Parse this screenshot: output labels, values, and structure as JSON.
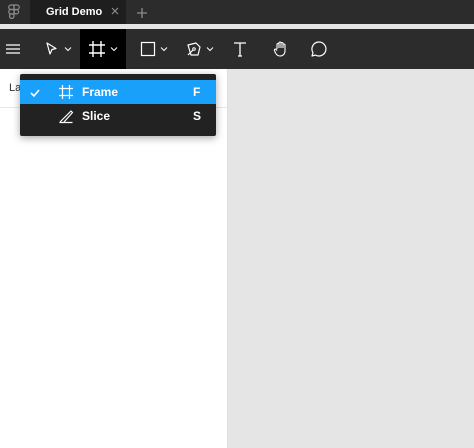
{
  "tabbar": {
    "tab_title": "Grid Demo",
    "icons": [
      "figma-logo-icon",
      "close-icon",
      "plus-icon"
    ]
  },
  "toolbar": {
    "tools": [
      "menu-icon",
      "move-tool-icon",
      "frame-tool-icon",
      "rectangle-tool-icon",
      "pen-tool-icon",
      "text-tool-icon",
      "hand-tool-icon",
      "comment-tool-icon"
    ],
    "active_tool": "frame"
  },
  "left_panel": {
    "layers_label": "La"
  },
  "dropdown": {
    "items": [
      {
        "label": "Frame",
        "shortcut": "F",
        "icon": "frame-icon",
        "checked": true
      },
      {
        "label": "Slice",
        "shortcut": "S",
        "icon": "slice-icon",
        "checked": false
      }
    ]
  },
  "colors": {
    "tabbar_bg": "#2c2c2c",
    "toolbar_bg": "#2c2c2c",
    "active_tool_bg": "#000000",
    "menu_bg": "#222222",
    "menu_selected": "#18a0fb",
    "canvas_bg": "#e5e5e5"
  }
}
